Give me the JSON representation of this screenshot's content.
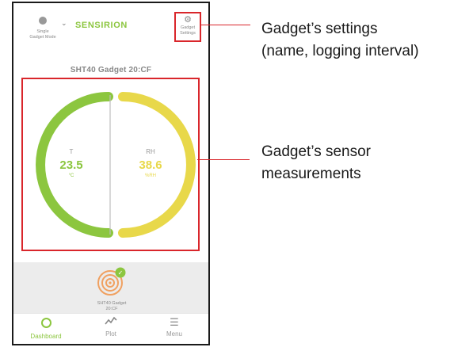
{
  "header": {
    "mode_label_line1": "Single",
    "mode_label_line2": "Gadget Mode",
    "brand": "SENSIRION",
    "settings_label_line1": "Gadget",
    "settings_label_line2": "Settings"
  },
  "gadget": {
    "title": "SHT40 Gadget 20:CF"
  },
  "gauges": {
    "temperature": {
      "label": "T",
      "value": "23.5",
      "unit": "°C",
      "color": "#8cc63f"
    },
    "humidity": {
      "label": "RH",
      "value": "38.6",
      "unit": "%RH",
      "color": "#e8d84a"
    }
  },
  "device_tray": {
    "label_line1": "SHT40 Gadget",
    "label_line2": "20:CF",
    "connected_badge": "✓"
  },
  "nav": {
    "items": [
      {
        "label": "Dashboard"
      },
      {
        "label": "Plot"
      },
      {
        "label": "Menu"
      }
    ]
  },
  "callouts": {
    "settings_line1": "Gadget’s settings",
    "settings_line2": "(name, logging interval)",
    "measurements_line1": "Gadget’s sensor",
    "measurements_line2": "measurements"
  },
  "colors": {
    "accent_green": "#8cc63f",
    "accent_yellow": "#e8d84a",
    "highlight_red": "#d9262b"
  }
}
